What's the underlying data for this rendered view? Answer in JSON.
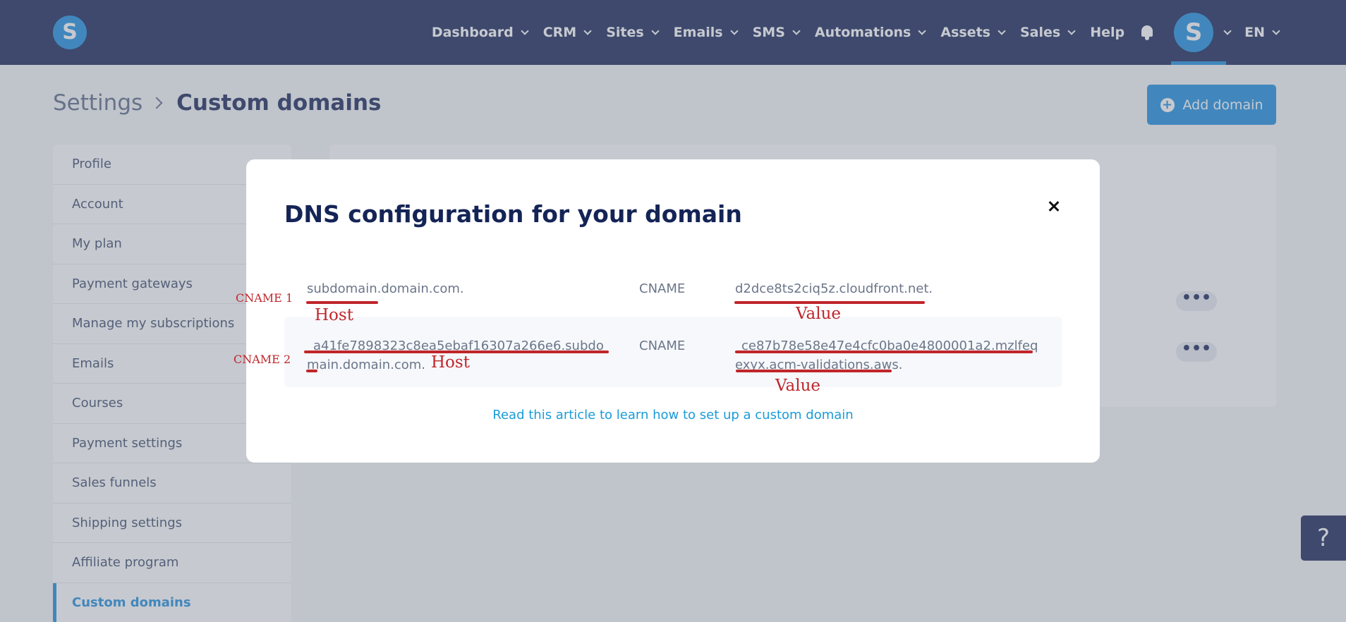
{
  "topnav": {
    "logo_letter": "S",
    "items": [
      {
        "label": "Dashboard",
        "has_dropdown": true
      },
      {
        "label": "CRM",
        "has_dropdown": true
      },
      {
        "label": "Sites",
        "has_dropdown": true
      },
      {
        "label": "Emails",
        "has_dropdown": true
      },
      {
        "label": "SMS",
        "has_dropdown": true
      },
      {
        "label": "Automations",
        "has_dropdown": true
      },
      {
        "label": "Assets",
        "has_dropdown": true
      },
      {
        "label": "Sales",
        "has_dropdown": true
      },
      {
        "label": "Help",
        "has_dropdown": false
      }
    ],
    "avatar_letter": "S",
    "language": "EN"
  },
  "header": {
    "breadcrumb_root": "Settings",
    "breadcrumb_current": "Custom domains",
    "add_domain_label": "Add domain"
  },
  "sidebar": {
    "items": [
      {
        "label": "Profile"
      },
      {
        "label": "Account"
      },
      {
        "label": "My plan"
      },
      {
        "label": "Payment gateways"
      },
      {
        "label": "Manage my subscriptions"
      },
      {
        "label": "Emails"
      },
      {
        "label": "Courses"
      },
      {
        "label": "Payment settings"
      },
      {
        "label": "Sales funnels"
      },
      {
        "label": "Shipping settings"
      },
      {
        "label": "Affiliate program"
      },
      {
        "label": "Custom domains",
        "active": true
      }
    ]
  },
  "panel": {
    "row_menu_label": "•••"
  },
  "help_fab": "?",
  "modal": {
    "title": "DNS configuration for your domain",
    "records": [
      {
        "host": "subdomain.domain.com.",
        "type": "CNAME",
        "value": "d2dce8ts2ciq5z.cloudfront.net."
      },
      {
        "host": "_a41fe7898323c8ea5ebaf16307a266e6.subdomain.domain.com.",
        "type": "CNAME",
        "value": "_ce87b78e58e47e4cfc0ba0e4800001a2.mzlfeqexyx.acm-validations.aws."
      }
    ],
    "help_link": "Read this article to learn how to set up a custom domain"
  },
  "annotations": {
    "cname1": "CNAME 1",
    "cname2": "CNAME 2",
    "host": "Host",
    "value": "Value",
    "color": "#c0262b"
  },
  "colors": {
    "nav_bg": "#152456",
    "accent": "#1b8de0",
    "link": "#1b9bd8"
  }
}
